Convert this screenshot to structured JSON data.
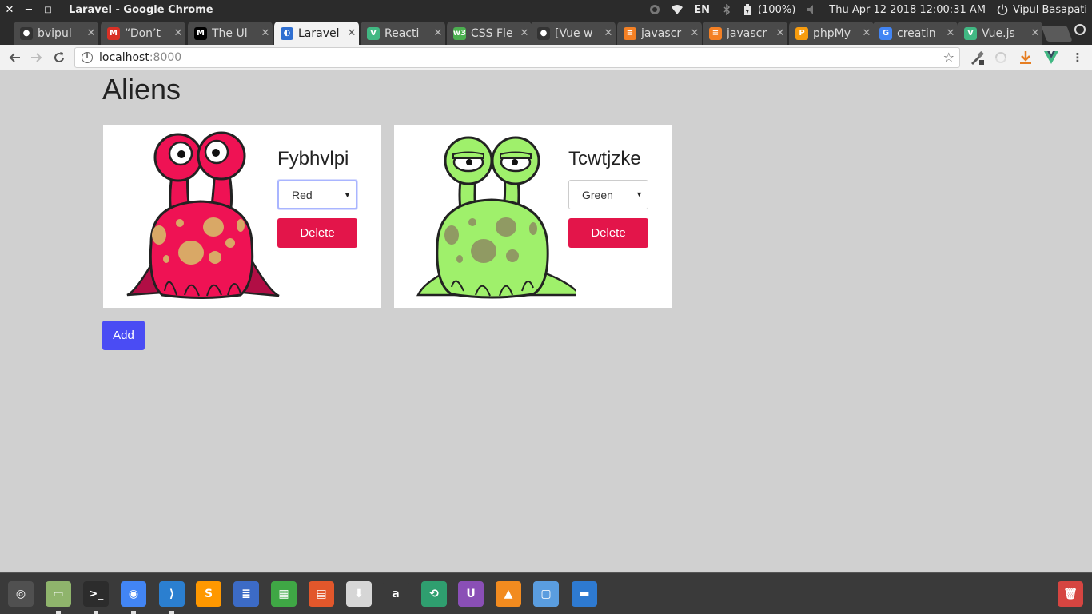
{
  "window": {
    "title": "Laravel - Google Chrome",
    "close_glyph": "✕",
    "minimize_glyph": "−",
    "maximize_glyph": "□"
  },
  "system_tray": {
    "language": "EN",
    "battery": "(100%)",
    "datetime": "Thu Apr 12 2018 12:00:31 AM",
    "user": "Vipul Basapati"
  },
  "tabs": [
    {
      "label": "bvipul",
      "icon": "github-icon",
      "color": "#333333",
      "active": false
    },
    {
      "label": "“Don’t",
      "icon": "gmail-icon",
      "color": "#d93025",
      "active": false
    },
    {
      "label": "The Ul",
      "icon": "medium-icon",
      "color": "#000000",
      "active": false
    },
    {
      "label": "Laravel",
      "icon": "laravel-icon",
      "color": "#2f6fd1",
      "active": true
    },
    {
      "label": "Reacti",
      "icon": "vue-icon",
      "color": "#41b883",
      "active": false
    },
    {
      "label": "CSS Fle",
      "icon": "w3schools-icon",
      "color": "#4caf50",
      "active": false
    },
    {
      "label": "[Vue w",
      "icon": "github-icon",
      "color": "#333333",
      "active": false
    },
    {
      "label": "javascr",
      "icon": "stackoverflow-icon",
      "color": "#f48024",
      "active": false
    },
    {
      "label": "javascr",
      "icon": "stackoverflow-icon",
      "color": "#f48024",
      "active": false
    },
    {
      "label": "phpMy",
      "icon": "phpmyadmin-icon",
      "color": "#f89c0e",
      "active": false
    },
    {
      "label": "creatin",
      "icon": "google-icon",
      "color": "#4285f4",
      "active": false
    },
    {
      "label": "Vue.js",
      "icon": "vue-icon",
      "color": "#41b883",
      "active": false
    }
  ],
  "address_bar": {
    "host": "localhost",
    "port": ":8000"
  },
  "page": {
    "title": "Aliens",
    "add_label": "Add",
    "aliens": [
      {
        "name": "Fybhvlpi",
        "color": "Red",
        "delete_label": "Delete",
        "body_color": "#ef1254",
        "body_shade": "#b10e45",
        "spot_color": "#d9a866"
      },
      {
        "name": "Tcwtjzke",
        "color": "Green",
        "delete_label": "Delete",
        "body_color": "#9ff06b",
        "body_shade": "#6fc74a",
        "spot_color": "#909a63"
      }
    ]
  },
  "taskbar": {
    "apps": [
      {
        "icon": "ubuntu-icon",
        "color": "#505050",
        "running": false
      },
      {
        "icon": "files-icon",
        "color": "#8fb46c",
        "running": true
      },
      {
        "icon": "terminal-icon",
        "color": "#2c2c2c",
        "running": true
      },
      {
        "icon": "chrome-icon",
        "color": "#4285f4",
        "running": true
      },
      {
        "icon": "vscode-icon",
        "color": "#2b7fd0",
        "running": true
      },
      {
        "icon": "sublime-icon",
        "color": "#ff9800",
        "running": false
      },
      {
        "icon": "writer-icon",
        "color": "#3c6bc6",
        "running": false
      },
      {
        "icon": "calc-icon",
        "color": "#3fa745",
        "running": false
      },
      {
        "icon": "impress-icon",
        "color": "#e2572b",
        "running": false
      },
      {
        "icon": "software-center-icon",
        "color": "#d6d6d6",
        "running": false
      },
      {
        "icon": "amazon-icon",
        "color": "#3a3a3a",
        "running": false
      },
      {
        "icon": "mintupdate-icon",
        "color": "#2f9e6f",
        "running": false
      },
      {
        "icon": "upwork-icon",
        "color": "#8a4fb6",
        "running": false
      },
      {
        "icon": "vlc-icon",
        "color": "#f28b1f",
        "running": false
      },
      {
        "icon": "screenshot-icon",
        "color": "#5a9ddf",
        "running": false
      },
      {
        "icon": "desktop-icon",
        "color": "#2e7ad1",
        "running": false
      },
      {
        "icon": "trash-icon",
        "color": "#d64541",
        "running": false
      }
    ]
  }
}
